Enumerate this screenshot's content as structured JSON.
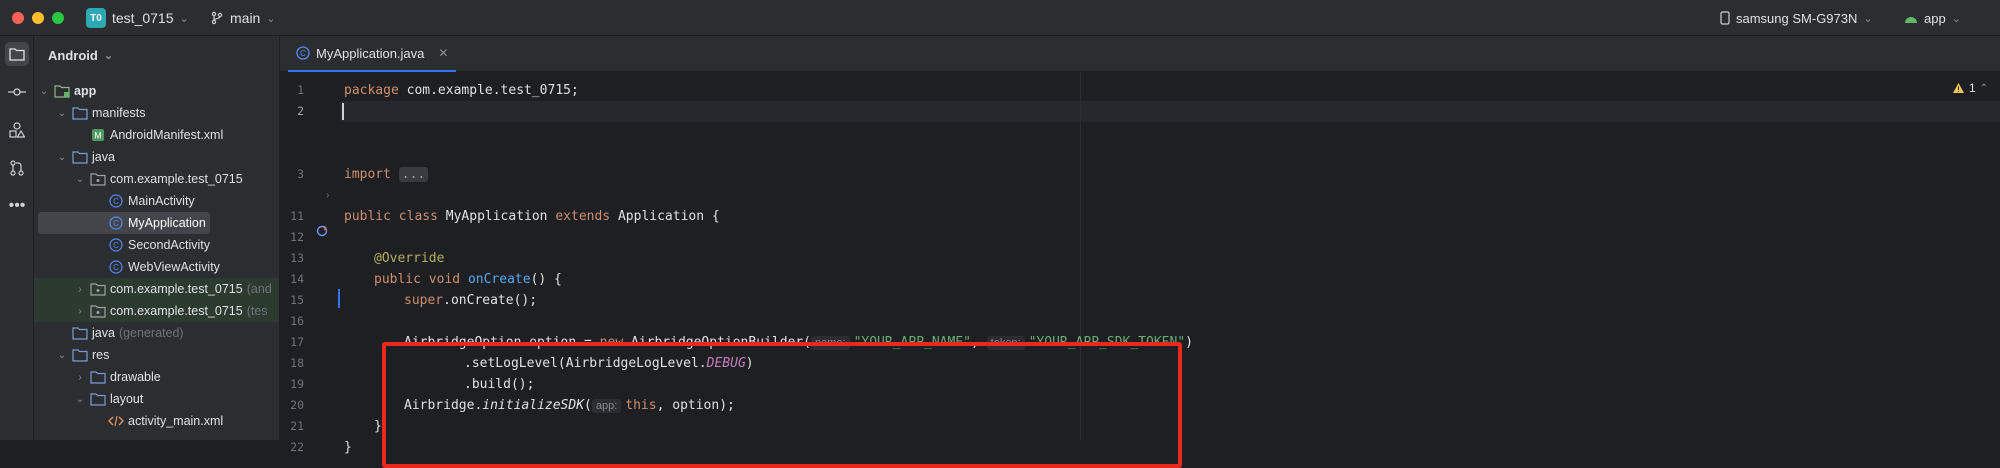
{
  "titlebar": {
    "project_badge": "T0",
    "project_name": "test_0715",
    "branch": "main",
    "device": "samsung SM-G973N",
    "run_config": "app"
  },
  "project_panel": {
    "view_mode": "Android",
    "tree": [
      {
        "label": "app",
        "suffix": ""
      },
      {
        "label": "manifests",
        "suffix": ""
      },
      {
        "label": "AndroidManifest.xml",
        "suffix": ""
      },
      {
        "label": "java",
        "suffix": ""
      },
      {
        "label": "com.example.test_0715",
        "suffix": ""
      },
      {
        "label": "MainActivity",
        "suffix": ""
      },
      {
        "label": "MyApplication",
        "suffix": ""
      },
      {
        "label": "SecondActivity",
        "suffix": ""
      },
      {
        "label": "WebViewActivity",
        "suffix": ""
      },
      {
        "label": "com.example.test_0715",
        "suffix": "(and"
      },
      {
        "label": "com.example.test_0715",
        "suffix": "(tes"
      },
      {
        "label": "java",
        "suffix": "(generated)"
      },
      {
        "label": "res",
        "suffix": ""
      },
      {
        "label": "drawable",
        "suffix": ""
      },
      {
        "label": "layout",
        "suffix": ""
      },
      {
        "label": "activity_main.xml",
        "suffix": ""
      }
    ]
  },
  "editor": {
    "tab_label": "MyApplication.java",
    "warnings_count": "1",
    "line_numbers": [
      "1",
      "2",
      "3",
      "11",
      "12",
      "13",
      "14",
      "15",
      "16",
      "17",
      "18",
      "19",
      "20",
      "21",
      "22"
    ],
    "tokens": {
      "package_kw": "package",
      "package_name": " com.example.test_0715;",
      "import_kw": "import",
      "import_fold": "...",
      "public_kw": "public",
      "class_kw": "class",
      "class_name": "MyApplication",
      "extends_kw": "extends",
      "parent_class": "Application {",
      "annotation": "@Override",
      "void_kw": "void",
      "method_name": "onCreate",
      "method_tail": "() {",
      "super_kw": "super",
      "super_call": ".onCreate();",
      "opt_type": "AirbridgeOption option = ",
      "new_kw": "new",
      "builder_call": "AirbridgeOptionBuilder(",
      "hint_name": "name:",
      "app_name": "\"YOUR_APP_NAME\"",
      "comma": ",",
      "hint_token": "token:",
      "sdk_token": "\"YOUR_APP_SDK_TOKEN\"",
      "close_paren": ")",
      "set_log": ".setLogLevel(AirbridgeLogLevel.",
      "debug": "DEBUG",
      "set_log_tail": ")",
      "build": ".build();",
      "airbridge": "Airbridge.",
      "init_sdk": "initializeSDK",
      "init_open": "(",
      "hint_app": "app:",
      "this_kw": "this",
      "init_tail": ", option);",
      "close_method": "}",
      "close_class": "}"
    }
  },
  "colors": {
    "highlight_box": "#e8291c",
    "accent": "#3574f0"
  }
}
